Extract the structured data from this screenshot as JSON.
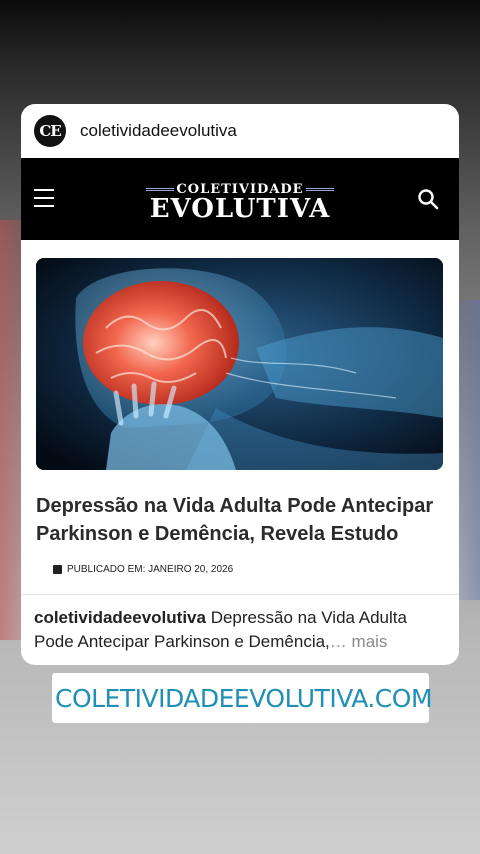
{
  "account": {
    "avatar_initials": "CE",
    "username": "coletividadeevolutiva"
  },
  "site": {
    "logo_top": "COLETIVIDADE",
    "logo_main": "EVOLUTIVA"
  },
  "article": {
    "headline": "Depressão na Vida Adulta Pode Antecipar Parkinson e Demência, Revela Estudo",
    "published": "PUBLICADO EM: JANEIRO 20, 2026"
  },
  "caption": {
    "username": "coletividadeevolutiva",
    "text": "Depressão na Vida Adulta Pode Antecipar Parkinson e Demência,",
    "ellipsis": "…",
    "more": "mais"
  },
  "link_sticker": {
    "label": "COLETIVIDADEEVOLUTIVA.COM"
  },
  "colors": {
    "link": "#1f8fb6",
    "site_bar": "#000000",
    "card": "#ffffff"
  }
}
